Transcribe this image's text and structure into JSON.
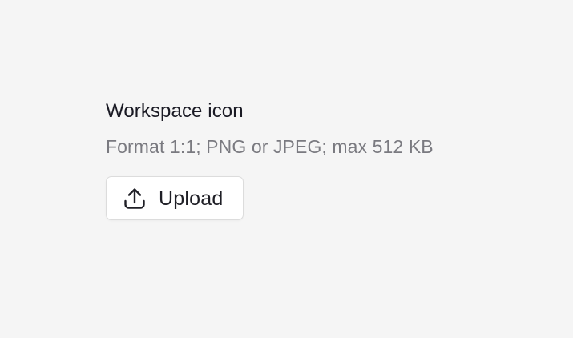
{
  "section": {
    "title": "Workspace icon",
    "subtitle": "Format 1:1; PNG or JPEG; max 512 KB"
  },
  "upload_button": {
    "label": "Upload",
    "icon": "upload-icon"
  }
}
